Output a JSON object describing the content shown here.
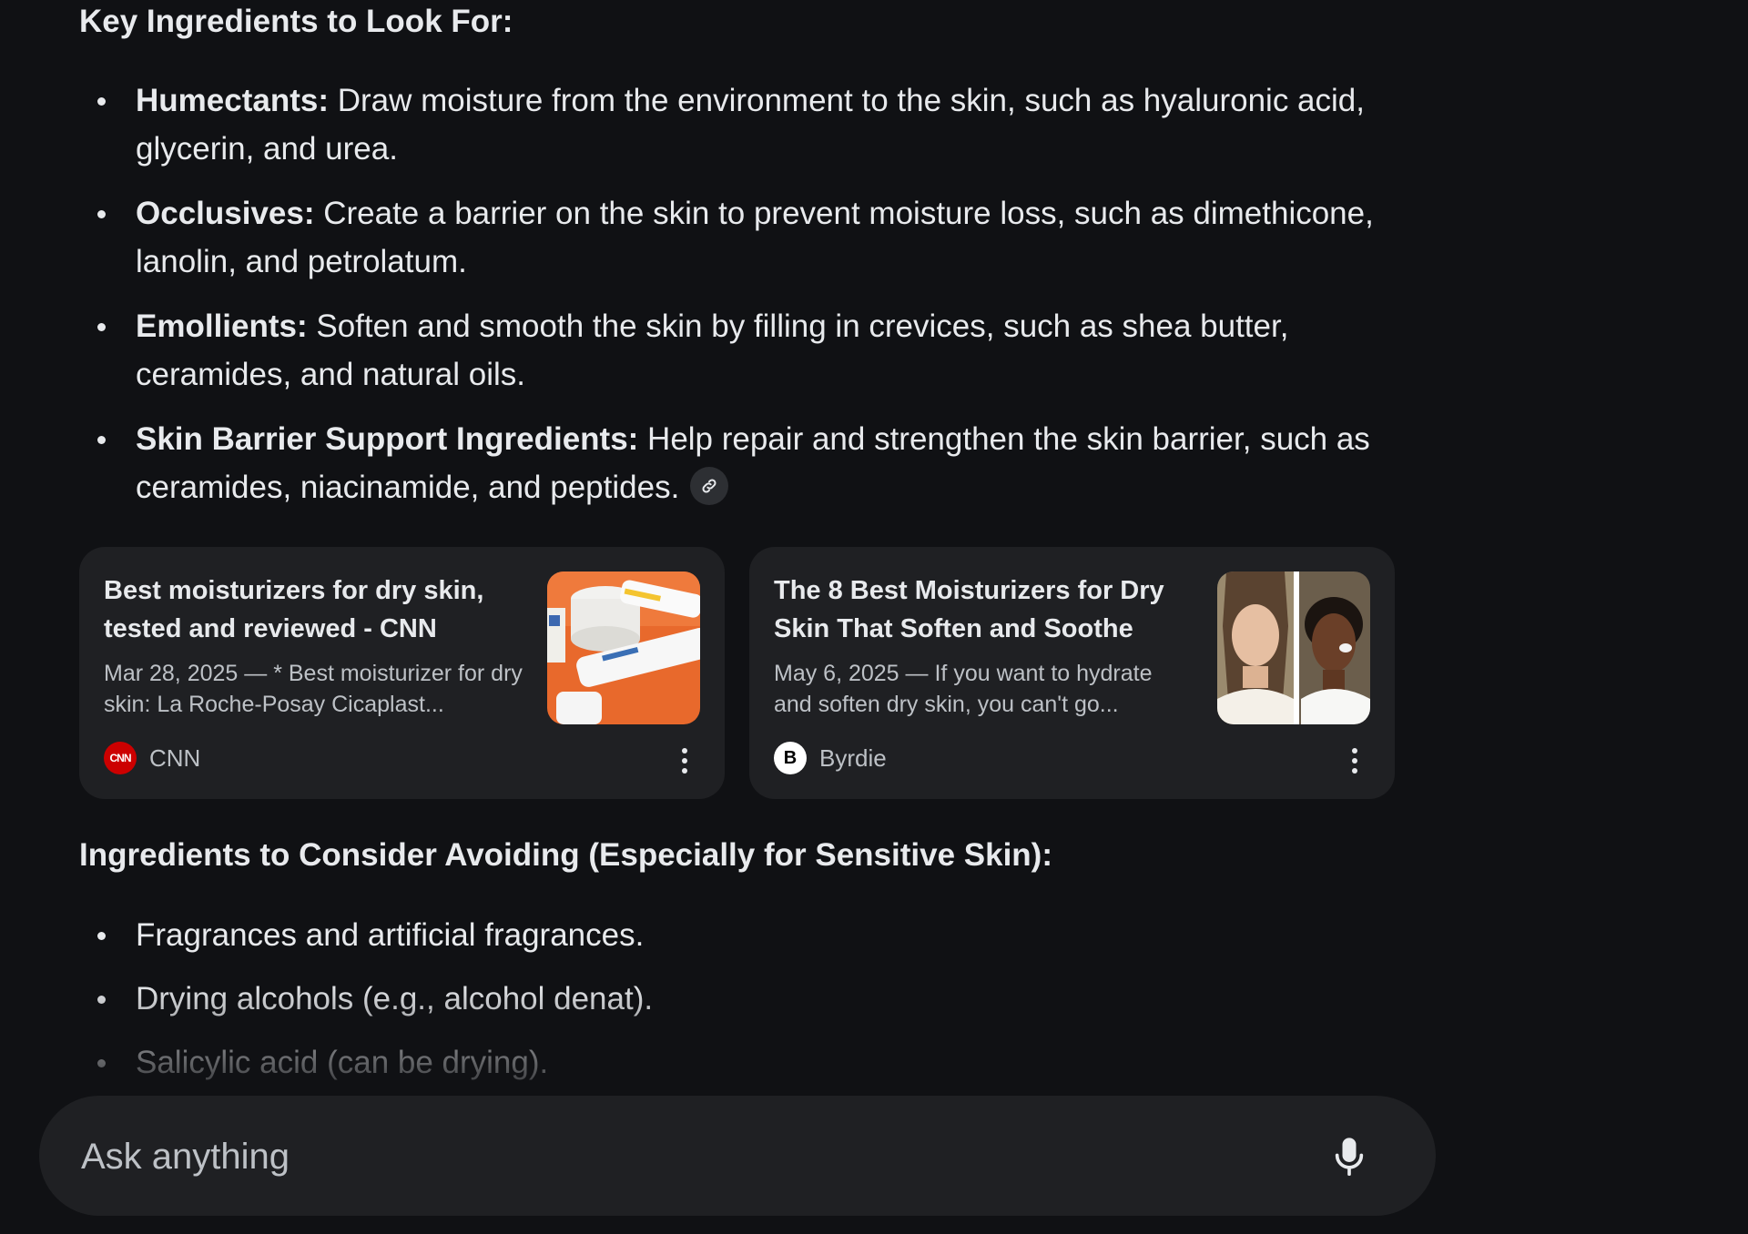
{
  "section1": {
    "heading": "Key Ingredients to Look For:",
    "items": [
      {
        "term": "Humectants:",
        "text": " Draw moisture from the environment to the skin, such as hyaluronic acid, glycerin, and urea."
      },
      {
        "term": "Occlusives:",
        "text": " Create a barrier on the skin to prevent moisture loss, such as dimethicone, lanolin, and petrolatum."
      },
      {
        "term": "Emollients:",
        "text": " Soften and smooth the skin by filling in crevices, such as shea butter, ceramides, and natural oils."
      },
      {
        "term": "Skin Barrier Support Ingredients:",
        "text": " Help repair and strengthen the skin barrier, such as ceramides, niacinamide, and peptides."
      }
    ]
  },
  "cards": [
    {
      "title": "Best moisturizers for dry skin, tested and reviewed - CNN",
      "snippet": "Mar 28, 2025 — * Best moisturizer for dry skin: La Roche-Posay Cicaplast...",
      "source": "CNN",
      "favicon_text": "CNN"
    },
    {
      "title": "The 8 Best Moisturizers for Dry Skin That Soften and Soothe",
      "snippet": "May 6, 2025 — If you want to hydrate and soften dry skin, you can't go...",
      "source": "Byrdie",
      "favicon_text": "B"
    }
  ],
  "section2": {
    "heading": "Ingredients to Consider Avoiding (Especially for Sensitive Skin):",
    "items": [
      "Fragrances and artificial fragrances.",
      "Drying alcohols (e.g., alcohol denat).",
      "Salicylic acid (can be drying)."
    ]
  },
  "ask_bar": {
    "placeholder": "Ask anything"
  },
  "icons": {
    "link": "link-icon",
    "mic": "microphone-icon",
    "more": "more-vert-icon"
  }
}
